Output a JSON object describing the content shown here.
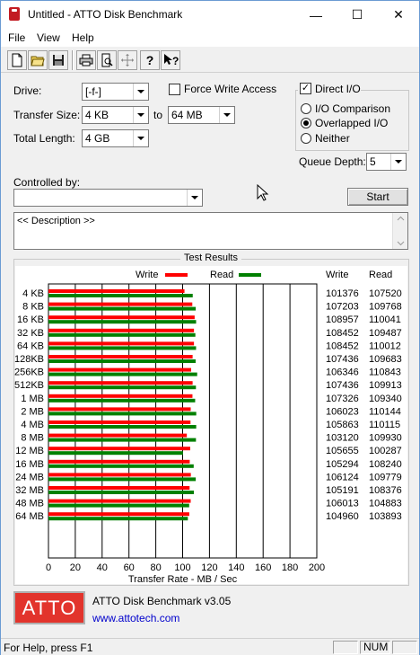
{
  "window": {
    "title": "Untitled - ATTO Disk Benchmark"
  },
  "titlebar_buttons": {
    "minimize": "—",
    "maximize": "☐",
    "close": "✕"
  },
  "menu": {
    "file": "File",
    "view": "View",
    "help": "Help"
  },
  "toolbar": {
    "icons": [
      "new-file-icon",
      "open-folder-icon",
      "save-icon",
      "print-icon",
      "print-preview-icon",
      "move-icon",
      "help-icon",
      "context-help-icon"
    ]
  },
  "form": {
    "drive_label": "Drive:",
    "drive_value": "[-f-]",
    "force_write_label": "Force Write Access",
    "force_write_checked": false,
    "direct_io_label": "Direct I/O",
    "direct_io_checked": true,
    "transfer_size_label": "Transfer Size:",
    "transfer_from": "4 KB",
    "to_label": "to",
    "transfer_to": "64 MB",
    "total_length_label": "Total Length:",
    "total_length_value": "4 GB",
    "io_comparison_label": "I/O Comparison",
    "overlapped_io_label": "Overlapped I/O",
    "neither_label": "Neither",
    "selected_mode": "Overlapped I/O",
    "queue_depth_label": "Queue Depth:",
    "queue_depth_value": "5",
    "controlled_by_label": "Controlled by:",
    "controlled_by_value": "",
    "start_label": "Start",
    "description": "<< Description >>"
  },
  "results": {
    "title": "Test Results",
    "legend_write": "Write",
    "legend_read": "Read",
    "col_write": "Write",
    "col_read": "Read"
  },
  "chart_data": {
    "type": "bar",
    "orientation": "horizontal",
    "categories": [
      "4 KB",
      "8 KB",
      "16 KB",
      "32 KB",
      "64 KB",
      "128KB",
      "256KB",
      "512KB",
      "1 MB",
      "2 MB",
      "4 MB",
      "8 MB",
      "12 MB",
      "16 MB",
      "24 MB",
      "32 MB",
      "48 MB",
      "64 MB"
    ],
    "series": [
      {
        "name": "Write",
        "color": "#ff0000",
        "values": [
          101376,
          107203,
          108957,
          108452,
          108452,
          107436,
          106346,
          107436,
          107326,
          106023,
          105863,
          103120,
          105655,
          105294,
          106124,
          105191,
          106013,
          104960
        ]
      },
      {
        "name": "Read",
        "color": "#008000",
        "values": [
          107520,
          109768,
          110041,
          109487,
          110012,
          109683,
          110843,
          109913,
          109340,
          110144,
          110115,
          109930,
          100287,
          108240,
          109779,
          108376,
          104883,
          103893
        ]
      }
    ],
    "xlabel": "Transfer Rate - MB / Sec",
    "xlim": [
      0,
      200
    ],
    "xticks": [
      "0",
      "20",
      "40",
      "60",
      "80",
      "100",
      "120",
      "140",
      "160",
      "180",
      "200"
    ],
    "grid": true
  },
  "footer": {
    "logo_text": "ATTO",
    "product": "ATTO Disk Benchmark v3.05",
    "url": "www.attotech.com"
  },
  "status": {
    "help_text": "For Help, press F1",
    "num": "NUM"
  },
  "colors": {
    "write": "#ff0000",
    "read": "#008000",
    "logo_bg": "#e2342c",
    "link": "#0000cc"
  }
}
